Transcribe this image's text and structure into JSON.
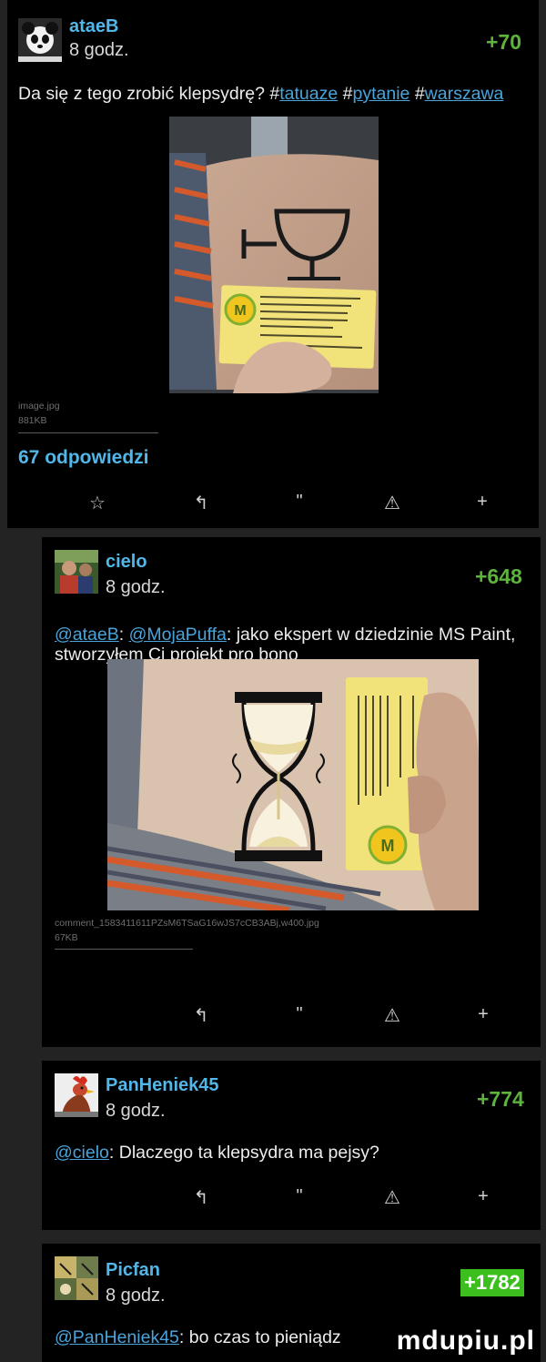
{
  "post": {
    "author": "ataeB",
    "time": "8 godz.",
    "votes": "+70",
    "text": "Da się z tego zrobić klepsydrę?",
    "tags": [
      "#tatuaze",
      "#pytanie",
      "#warszawa"
    ],
    "attachment_name": "image.jpg",
    "attachment_size": "881KB",
    "replies_label": "67 odpowiedzi"
  },
  "actions": {
    "star": "☆",
    "reply": "↰",
    "quote": "\"",
    "report": "⚠",
    "plus": "+"
  },
  "comments": [
    {
      "author": "cielo",
      "time": "8 godz.",
      "votes": "+648",
      "mentions": [
        "@ataeB",
        "@MojaPuffa"
      ],
      "text_line1": ": jako ekspert w dziedzinie MS Paint,",
      "text_line2": "stworzyłem Ci projekt pro bono",
      "attachment_name": "comment_1583411611PZsM6TSaG16wJS7cCB3ABj,w400.jpg",
      "attachment_size": "67KB"
    },
    {
      "author": "PanHeniek45",
      "time": "8 godz.",
      "votes": "+774",
      "mention": "@cielo",
      "text": ": Dlaczego ta klepsydra ma pejsy?"
    },
    {
      "author": "Picfan",
      "time": "8 godz.",
      "votes": "+1782",
      "mention": "@PanHeniek45",
      "text": ": bo czas to pieniądz"
    }
  ],
  "watermark": "mdupiu.pl",
  "colors": {
    "author": "#52b7e8",
    "votes": "#5db33d",
    "highlight_votes_bg": "#3cbf1e",
    "link": "#4aa3d9",
    "background": "#000000",
    "gutter": "#232323"
  }
}
